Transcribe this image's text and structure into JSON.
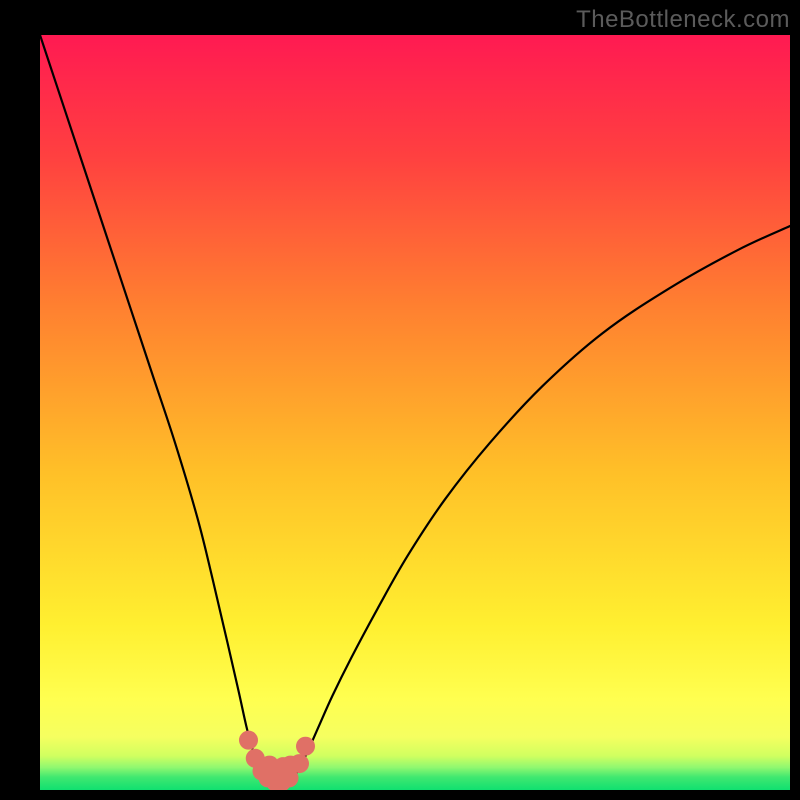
{
  "watermark": "TheBottleneck.com",
  "chart_data": {
    "type": "line",
    "title": "",
    "xlabel": "",
    "ylabel": "",
    "xlim": [
      0,
      100
    ],
    "ylim": [
      0,
      100
    ],
    "grid": false,
    "legend": false,
    "background_gradient": {
      "top_color": "#ff1a52",
      "mid_color": "#ffb030",
      "lower_color": "#ffff50",
      "bottom_strip_color": "#10e070"
    },
    "annotations": [],
    "series": [
      {
        "name": "left-branch",
        "description": "Steep descending curve from upper-left into the valley",
        "x": [
          0,
          3,
          6,
          9,
          12,
          15,
          18,
          21,
          23,
          25,
          26.5,
          27.5,
          28.3,
          29,
          29.6,
          30.2
        ],
        "y": [
          100,
          91,
          82,
          73,
          64,
          55,
          46,
          36,
          28,
          19.5,
          13,
          8.5,
          5.5,
          3.5,
          2.2,
          1.4
        ]
      },
      {
        "name": "right-branch",
        "description": "Ascending curve out of the valley toward upper-right",
        "x": [
          33.5,
          34.2,
          35,
          36,
          37.2,
          39,
          41.5,
          45,
          49,
          54,
          60,
          67,
          75,
          84,
          93,
          100
        ],
        "y": [
          1.4,
          2.3,
          3.7,
          5.8,
          8.5,
          12.5,
          17.5,
          24,
          31,
          38.5,
          46,
          53.5,
          60.5,
          66.5,
          71.5,
          74.7
        ]
      },
      {
        "name": "valley-floor",
        "description": "Short rounded valley bottom between branches",
        "x": [
          30.2,
          30.8,
          31.4,
          32.0,
          32.7,
          33.5
        ],
        "y": [
          1.4,
          1.05,
          0.92,
          0.92,
          1.05,
          1.4
        ]
      },
      {
        "name": "valley-markers",
        "description": "Salmon/coral dotted markers clustered at the valley bottom",
        "type": "scatter",
        "color": "#e07066",
        "x": [
          27.8,
          28.7,
          29.6,
          30.4,
          30.6,
          31.4,
          32.2,
          32.4,
          33.2,
          33.4,
          34.6,
          35.4
        ],
        "y": [
          6.6,
          4.2,
          2.5,
          1.6,
          3.3,
          1.05,
          1.05,
          3.1,
          1.6,
          3.3,
          3.5,
          5.8
        ]
      }
    ]
  }
}
